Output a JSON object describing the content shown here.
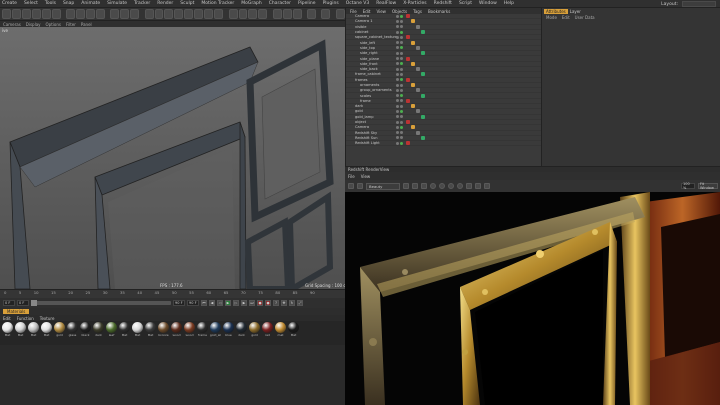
{
  "menubar": {
    "items": [
      "Create",
      "Select",
      "Tools",
      "Snap",
      "Animate",
      "Simulate",
      "Tracker",
      "Render",
      "Sculpt",
      "Motion Tracker",
      "MoGraph",
      "Character",
      "Pipeline",
      "Plugins",
      "Octane V3",
      "RealFlow",
      "X-Particles",
      "Redshift",
      "Script",
      "Window",
      "Help"
    ],
    "layout_label": "Layout:"
  },
  "viewport": {
    "menu": [
      "Cameras",
      "Display",
      "Options",
      "Filter",
      "Panel"
    ],
    "label_topleft": "ive",
    "status_fps": "FPS : 177.6",
    "status_grid": "Grid Spacing : 100 cm"
  },
  "timeline": {
    "ticks": [
      "0",
      "5",
      "10",
      "15",
      "20",
      "25",
      "30",
      "35",
      "40",
      "45",
      "50",
      "55",
      "60",
      "65",
      "70",
      "75",
      "80",
      "85",
      "90"
    ]
  },
  "playbar": {
    "start": "0 F",
    "current": "0 F",
    "end": "90 F",
    "end2": "90 F"
  },
  "materials": {
    "tab": "Materials",
    "menu": [
      "Edit",
      "Function",
      "Texture"
    ],
    "items": [
      {
        "name": "Mat",
        "color": "#e8e8e8"
      },
      {
        "name": "Mat",
        "color": "#d0d0d0"
      },
      {
        "name": "Mat",
        "color": "#bfbfbf"
      },
      {
        "name": "Mat",
        "color": "#e0e0e0"
      },
      {
        "name": "gold",
        "color": "#b08a40"
      },
      {
        "name": "glass",
        "color": "#303030"
      },
      {
        "name": "black",
        "color": "#202020"
      },
      {
        "name": "dark",
        "color": "#3b3b2a"
      },
      {
        "name": "leaf",
        "color": "#4a6a2a"
      },
      {
        "name": "Mat",
        "color": "#2e2e2e"
      },
      {
        "name": "Mat",
        "color": "#d8d8d8"
      },
      {
        "name": "Mat",
        "color": "#3a3a3a"
      },
      {
        "name": "bronze",
        "color": "#6a4a2a"
      },
      {
        "name": "wood",
        "color": "#5a2a1a"
      },
      {
        "name": "wood",
        "color": "#7a3a20"
      },
      {
        "name": "frame",
        "color": "#2a2a2a"
      },
      {
        "name": "gold_sil",
        "color": "#1e3a5a"
      },
      {
        "name": "blue",
        "color": "#1a3050"
      },
      {
        "name": "dark",
        "color": "#202830"
      },
      {
        "name": "gold",
        "color": "#8a6a2a"
      },
      {
        "name": "red",
        "color": "#7a2020"
      },
      {
        "name": "mat",
        "color": "#c08a30"
      },
      {
        "name": "Mat",
        "color": "#1a1a1a"
      }
    ]
  },
  "object_manager": {
    "menu": [
      "File",
      "Edit",
      "View",
      "Objects",
      "Tags",
      "Bookmarks"
    ],
    "rows": [
      {
        "name": "Camera",
        "indent": 1
      },
      {
        "name": "Camera 1",
        "indent": 1
      },
      {
        "name": "visible",
        "indent": 1
      },
      {
        "name": "cabinet",
        "indent": 1
      },
      {
        "name": "square_cabinet_texture",
        "indent": 1
      },
      {
        "name": "side_left",
        "indent": 2
      },
      {
        "name": "side_top",
        "indent": 2
      },
      {
        "name": "side_right",
        "indent": 2
      },
      {
        "name": "side_plane",
        "indent": 2
      },
      {
        "name": "side_front",
        "indent": 2
      },
      {
        "name": "side_back",
        "indent": 2
      },
      {
        "name": "frame_cabinet",
        "indent": 1
      },
      {
        "name": "frames",
        "indent": 1
      },
      {
        "name": "ornaments",
        "indent": 2
      },
      {
        "name": "group_ornaments",
        "indent": 2
      },
      {
        "name": "scales",
        "indent": 2
      },
      {
        "name": "frame",
        "indent": 2
      },
      {
        "name": "dark",
        "indent": 1
      },
      {
        "name": "gold",
        "indent": 1
      },
      {
        "name": "gold_lamp",
        "indent": 1
      },
      {
        "name": "object",
        "indent": 1
      },
      {
        "name": "Camera",
        "indent": 1
      },
      {
        "name": "Redshift Sky",
        "indent": 1
      },
      {
        "name": "Redshift Sun",
        "indent": 1
      },
      {
        "name": "Redshift Light",
        "indent": 1
      }
    ]
  },
  "attribute_manager": {
    "tabs": [
      "Attributes",
      "Layer"
    ],
    "menu": [
      "Mode",
      "Edit",
      "User Data"
    ]
  },
  "render_view": {
    "title": "Redshift RenderView",
    "menu": [
      "File",
      "View"
    ],
    "beauty_select": "Beauty",
    "zoom": "100 %",
    "fit": "Fit Window"
  },
  "colors": {
    "accent": "#d9a03a",
    "viewport_bg_top": "#6d6d6d",
    "render_bg": "#000000"
  }
}
